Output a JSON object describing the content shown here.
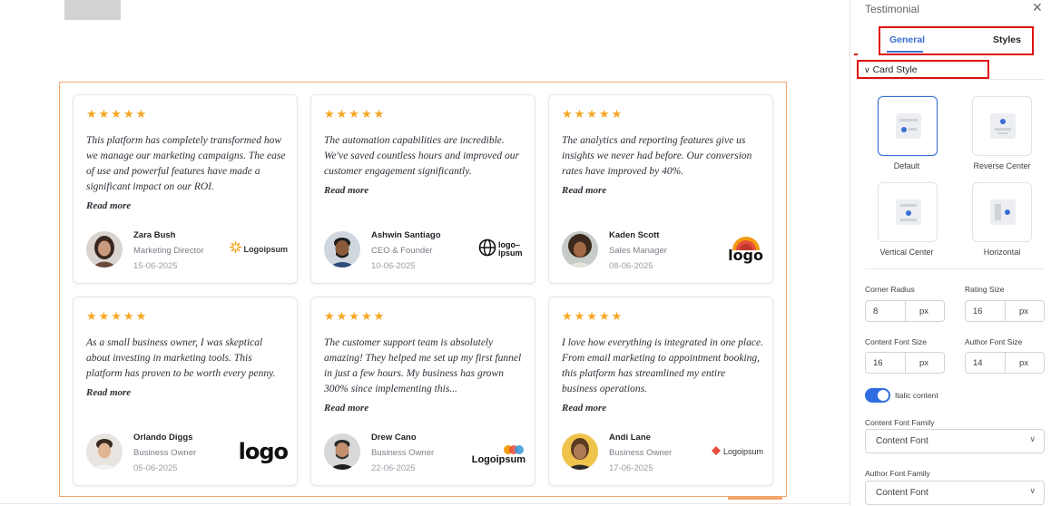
{
  "panel": {
    "title": "Testimonial",
    "tabs": [
      {
        "label": "General",
        "active": true
      },
      {
        "label": "Styles",
        "active": false
      }
    ],
    "section_title": "Card Style",
    "card_styles": [
      {
        "label": "Default",
        "selected": true
      },
      {
        "label": "Reverse Center",
        "selected": false
      },
      {
        "label": "Vertical Center",
        "selected": false
      },
      {
        "label": "Horizontal",
        "selected": false
      }
    ],
    "fields": {
      "corner_radius": {
        "label": "Corner Radius",
        "value": "8",
        "unit": "px"
      },
      "rating_size": {
        "label": "Rating Size",
        "value": "16",
        "unit": "px"
      },
      "content_font_size": {
        "label": "Content Font Size",
        "value": "16",
        "unit": "px"
      },
      "author_font_size": {
        "label": "Author Font Size",
        "value": "14",
        "unit": "px"
      }
    },
    "italic_toggle": {
      "label": "Italic content",
      "on": true
    },
    "content_font_family": {
      "label": "Content Font Family",
      "value": "Content Font"
    },
    "author_font_family": {
      "label": "Author Font Family",
      "value": "Content Font"
    }
  },
  "testimonials": [
    {
      "stars": "★★★★★",
      "quote": "This platform has completely transformed how we manage our marketing campaigns. The ease of use and powerful features have made a significant impact on our ROI.",
      "read_more": "Read more",
      "name": "Zara Bush",
      "role": "Marketing Director",
      "date": "15-06-2025",
      "brand": "Logoipsum",
      "brand_icon": "sunburst-logo-icon"
    },
    {
      "stars": "★★★★★",
      "quote": "The automation capabilities are incredible. We've saved countless hours and improved our customer engagement significantly.",
      "read_more": "Read more",
      "name": "Ashwin Santiago",
      "role": "CEO & Founder",
      "date": "10-06-2025",
      "brand": "logo–ipsum",
      "brand_icon": "globe-logo-icon"
    },
    {
      "stars": "★★★★★",
      "quote": "The analytics and reporting features give us insights we never had before. Our conversion rates have improved by 40%.",
      "read_more": "Read more",
      "name": "Kaden Scott",
      "role": "Sales Manager",
      "date": "08-06-2025",
      "brand": "logo",
      "brand_icon": "sunrise-logo-icon"
    },
    {
      "stars": "★★★★★",
      "quote": "As a small business owner, I was skeptical about investing in marketing tools. This platform has proven to be worth every penny.",
      "read_more": "Read more",
      "name": "Orlando Diggs",
      "role": "Business Owner",
      "date": "05-06-2025",
      "brand": "logo",
      "brand_icon": "bold-logo-icon"
    },
    {
      "stars": "★★★★★",
      "quote": "The customer support team is absolutely amazing! They helped me set up my first funnel in just a few hours. My business has grown 300% since implementing this...",
      "read_more": "Read more",
      "name": "Drew Cano",
      "role": "Business Owner",
      "date": "22-06-2025",
      "brand": "Logoipsum",
      "brand_icon": "colorful-logo-icon"
    },
    {
      "stars": "★★★★★",
      "quote": "I love how everything is integrated in one place. From email marketing to appointment booking, this platform has streamlined my entire business operations.",
      "read_more": "Read more",
      "name": "Andi Lane",
      "role": "Business Owner",
      "date": "17-06-2025",
      "brand": "Logoipsum",
      "brand_icon": "diamond-logo-icon"
    }
  ],
  "colors": {
    "accent": "#3b6fd4",
    "star": "#f5a623",
    "highlight": "#e10f0f",
    "selection": "#f4a56b",
    "toggle_on": "#2f6de0"
  }
}
